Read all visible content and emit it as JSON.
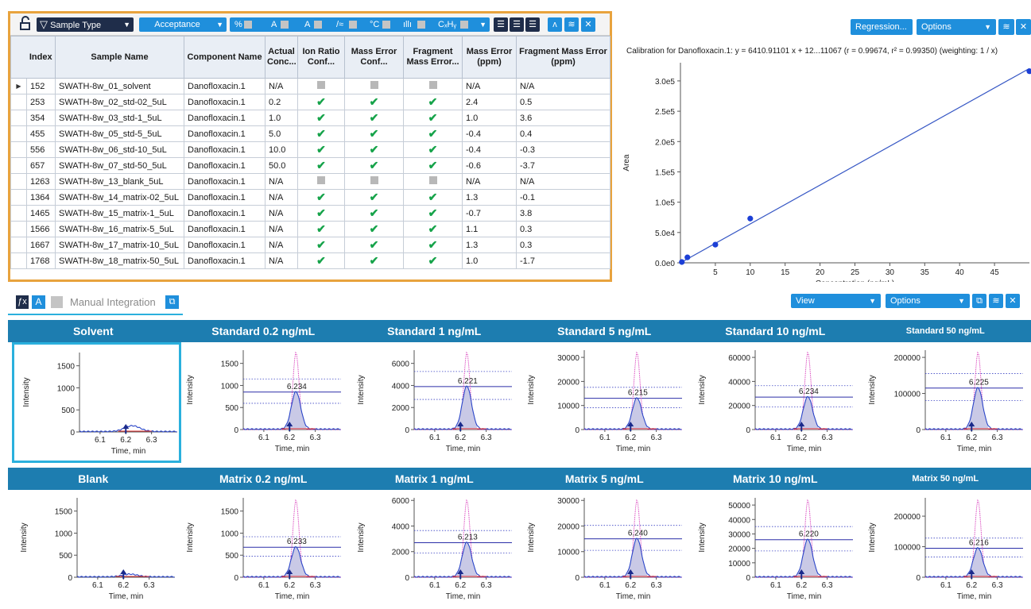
{
  "toolbar": {
    "filter_label": "Sample Type",
    "acceptance_label": "Acceptance"
  },
  "table": {
    "columns": [
      "Index",
      "Sample Name",
      "Component Name",
      "Actual Conc...",
      "Ion Ratio Conf...",
      "Mass Error Conf...",
      "Fragment Mass Error...",
      "Mass Error (ppm)",
      "Fragment Mass Error (ppm)"
    ],
    "rows": [
      {
        "index": "152",
        "name": "SWATH-8w_01_solvent",
        "component": "Danofloxacin.1",
        "conc": "N/A",
        "ion": "gray",
        "mass": "gray",
        "frag": "gray",
        "mass_err": "N/A",
        "frag_err": "N/A"
      },
      {
        "index": "253",
        "name": "SWATH-8w_02_std-02_5uL",
        "component": "Danofloxacin.1",
        "conc": "0.2",
        "ion": "check",
        "mass": "check",
        "frag": "check",
        "mass_err": "2.4",
        "frag_err": "0.5"
      },
      {
        "index": "354",
        "name": "SWATH-8w_03_std-1_5uL",
        "component": "Danofloxacin.1",
        "conc": "1.0",
        "ion": "check",
        "mass": "check",
        "frag": "check",
        "mass_err": "1.0",
        "frag_err": "3.6"
      },
      {
        "index": "455",
        "name": "SWATH-8w_05_std-5_5uL",
        "component": "Danofloxacin.1",
        "conc": "5.0",
        "ion": "check",
        "mass": "check",
        "frag": "check",
        "mass_err": "-0.4",
        "frag_err": "0.4"
      },
      {
        "index": "556",
        "name": "SWATH-8w_06_std-10_5uL",
        "component": "Danofloxacin.1",
        "conc": "10.0",
        "ion": "check",
        "mass": "check",
        "frag": "check",
        "mass_err": "-0.4",
        "frag_err": "-0.3"
      },
      {
        "index": "657",
        "name": "SWATH-8w_07_std-50_5uL",
        "component": "Danofloxacin.1",
        "conc": "50.0",
        "ion": "check",
        "mass": "check",
        "frag": "check",
        "mass_err": "-0.6",
        "frag_err": "-3.7"
      },
      {
        "index": "1263",
        "name": "SWATH-8w_13_blank_5uL",
        "component": "Danofloxacin.1",
        "conc": "N/A",
        "ion": "gray",
        "mass": "gray",
        "frag": "gray",
        "mass_err": "N/A",
        "frag_err": "N/A"
      },
      {
        "index": "1364",
        "name": "SWATH-8w_14_matrix-02_5uL",
        "component": "Danofloxacin.1",
        "conc": "N/A",
        "ion": "check",
        "mass": "check",
        "frag": "check",
        "mass_err": "1.3",
        "frag_err": "-0.1"
      },
      {
        "index": "1465",
        "name": "SWATH-8w_15_matrix-1_5uL",
        "component": "Danofloxacin.1",
        "conc": "N/A",
        "ion": "check",
        "mass": "check",
        "frag": "check",
        "mass_err": "-0.7",
        "frag_err": "3.8"
      },
      {
        "index": "1566",
        "name": "SWATH-8w_16_matrix-5_5uL",
        "component": "Danofloxacin.1",
        "conc": "N/A",
        "ion": "check",
        "mass": "check",
        "frag": "check",
        "mass_err": "1.1",
        "frag_err": "0.3"
      },
      {
        "index": "1667",
        "name": "SWATH-8w_17_matrix-10_5uL",
        "component": "Danofloxacin.1",
        "conc": "N/A",
        "ion": "check",
        "mass": "check",
        "frag": "check",
        "mass_err": "1.3",
        "frag_err": "0.3"
      },
      {
        "index": "1768",
        "name": "SWATH-8w_18_matrix-50_5uL",
        "component": "Danofloxacin.1",
        "conc": "N/A",
        "ion": "check",
        "mass": "check",
        "frag": "check",
        "mass_err": "1.0",
        "frag_err": "-1.7"
      }
    ]
  },
  "calibration": {
    "regression_label": "Regression...",
    "options_label": "Options",
    "title": "Calibration for Danofloxacin.1: y = 6410.91101 x + 12...11067 (r = 0.99674, r² = 0.99350)  (weighting: 1 / x)"
  },
  "integration": {
    "manual_label": "Manual Integration",
    "view_label": "View",
    "options_label": "Options"
  },
  "chart_data": [
    {
      "type": "scatter",
      "title": "Calibration for Danofloxacin.1: y = 6410.91101 x + 12...11067 (r = 0.99674, r² = 0.99350)  (weighting: 1 / x)",
      "xlabel": "Concentration (ng/mL)",
      "ylabel": "Area",
      "xlim": [
        0,
        50
      ],
      "ylim": [
        0,
        330000
      ],
      "xticks": [
        "5",
        "10",
        "15",
        "20",
        "25",
        "30",
        "35",
        "40",
        "45"
      ],
      "yticks": [
        "0.0e0",
        "5.0e4",
        "1.0e5",
        "1.5e5",
        "2.0e5",
        "2.5e5",
        "3.0e5"
      ],
      "points": [
        {
          "x": 0.2,
          "y": 1300
        },
        {
          "x": 1,
          "y": 9000
        },
        {
          "x": 5,
          "y": 30000
        },
        {
          "x": 10,
          "y": 73000
        },
        {
          "x": 50,
          "y": 316000
        }
      ],
      "fit": {
        "slope": 6410.91101,
        "intercept": 0
      }
    },
    {
      "type": "line",
      "rows": [
        {
          "cells": [
            {
              "title": "Solvent",
              "ymax": 1800,
              "yticks": [
                0,
                500,
                1000,
                1500
              ],
              "peak": 130,
              "rt": ""
            },
            {
              "title": "Standard 0.2 ng/mL",
              "ymax": 1800,
              "yticks": [
                0,
                500,
                1000,
                1500
              ],
              "peak": 850,
              "rt": "6.234"
            },
            {
              "title": "Standard 1 ng/mL",
              "ymax": 7200,
              "yticks": [
                0,
                2000,
                4000,
                6000
              ],
              "peak": 3900,
              "rt": "6.221"
            },
            {
              "title": "Standard 5 ng/mL",
              "ymax": 33000,
              "yticks": [
                0,
                10000,
                20000,
                30000
              ],
              "peak": 13000,
              "rt": "6.215"
            },
            {
              "title": "Standard 10 ng/mL",
              "ymax": 66000,
              "yticks": [
                0,
                20000,
                40000,
                60000
              ],
              "peak": 27000,
              "rt": "6.234"
            },
            {
              "title": "Standard 50 ng/mL",
              "ymax": 220000,
              "yticks": [
                0,
                100000,
                200000
              ],
              "peak": 115000,
              "rt": "6.225"
            }
          ]
        },
        {
          "cells": [
            {
              "title": "Blank",
              "ymax": 1800,
              "yticks": [
                0,
                500,
                1000,
                1500
              ],
              "peak": 60,
              "rt": ""
            },
            {
              "title": "Matrix 0.2 ng/mL",
              "ymax": 1800,
              "yticks": [
                0,
                500,
                1000,
                1500
              ],
              "peak": 680,
              "rt": "6.233"
            },
            {
              "title": "Matrix 1 ng/mL",
              "ymax": 6200,
              "yticks": [
                0,
                2000,
                4000,
                6000
              ],
              "peak": 2700,
              "rt": "6.213"
            },
            {
              "title": "Matrix 5 ng/mL",
              "ymax": 31000,
              "yticks": [
                0,
                10000,
                20000,
                30000
              ],
              "peak": 15000,
              "rt": "6.240"
            },
            {
              "title": "Matrix 10 ng/mL",
              "ymax": 55000,
              "yticks": [
                0,
                10000,
                20000,
                30000,
                40000,
                50000
              ],
              "peak": 26000,
              "rt": "6.220"
            },
            {
              "title": "Matrix 50 ng/mL",
              "ymax": 260000,
              "yticks": [
                0,
                100000,
                200000
              ],
              "peak": 95000,
              "rt": "6.216"
            }
          ]
        }
      ],
      "xticks": [
        "6.1",
        "6.2",
        "6.3"
      ],
      "xlabel": "Time, min",
      "ylabel": "Intensity"
    }
  ]
}
